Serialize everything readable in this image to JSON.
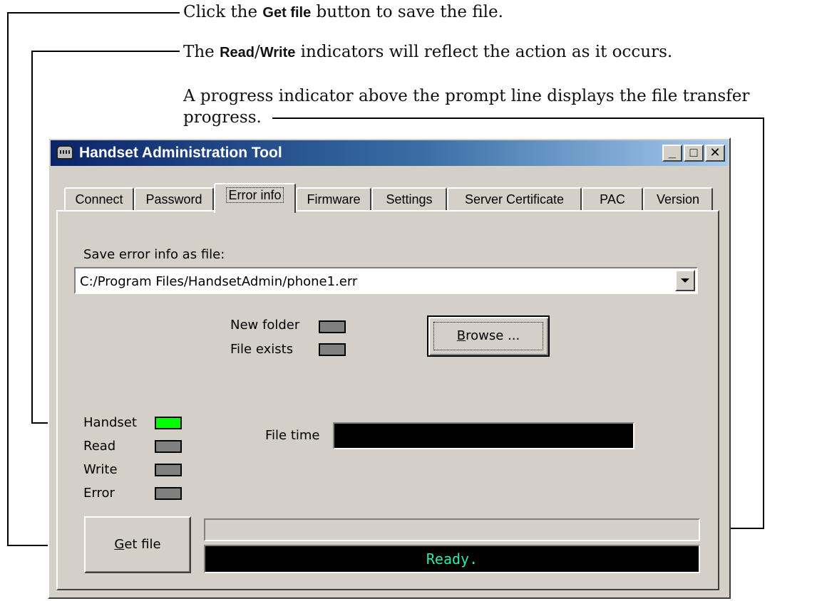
{
  "notes": {
    "line1_pre": "Click the ",
    "line1_bold": "Get file",
    "line1_post": " button to save the file.",
    "line2_pre": "The ",
    "line2_bold1": "Read",
    "line2_sep": "/",
    "line2_bold2": "Write",
    "line2_post": " indicators will reflect the action as it occurs.",
    "line3a": "A progress indicator above the prompt line displays the file transfer",
    "line3b": "progress."
  },
  "window": {
    "title": "Handset Administration Tool",
    "controls": {
      "minimize": "_",
      "maximize": "□",
      "close": "✕"
    }
  },
  "tabs": [
    {
      "label": "Connect"
    },
    {
      "label": "Password"
    },
    {
      "label": "Error info"
    },
    {
      "label": "Firmware"
    },
    {
      "label": "Settings"
    },
    {
      "label": "Server Certificate"
    },
    {
      "label": "PAC"
    },
    {
      "label": "Version"
    }
  ],
  "active_tab": "Error info",
  "save_section": {
    "label": "Save error info as file:",
    "path_value": "C:/Program Files/HandsetAdmin/phone1.err"
  },
  "folder_indicators": [
    {
      "label": "New folder",
      "state": "off"
    },
    {
      "label": "File exists",
      "state": "off"
    }
  ],
  "browse_button": {
    "label_pre": "",
    "label_ul": "B",
    "label_post": "rowse ..."
  },
  "status_indicators": [
    {
      "label": "Handset",
      "state": "on"
    },
    {
      "label": "Read",
      "state": "off"
    },
    {
      "label": "Write",
      "state": "off"
    },
    {
      "label": "Error",
      "state": "off"
    }
  ],
  "file_time": {
    "label": "File time",
    "value": ""
  },
  "get_file_button": {
    "label_ul": "G",
    "label_post": "et file"
  },
  "progress": {
    "percent": 0
  },
  "status_line": "Ready.",
  "colors": {
    "indicator_on": "#00ff00",
    "indicator_off": "#808080",
    "status_text": "#2ee8b0",
    "title_gradient_start": "#0a246a",
    "title_gradient_end": "#a6caf0"
  }
}
